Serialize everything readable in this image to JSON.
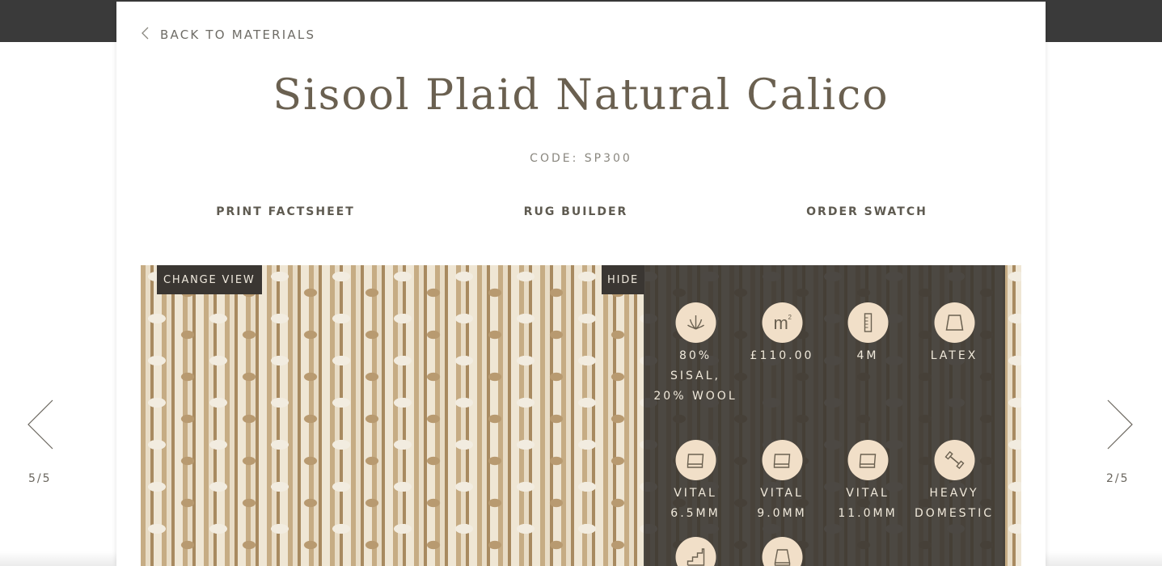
{
  "header": {
    "back_label": "BACK TO MATERIALS"
  },
  "product": {
    "title": "Sisool Plaid Natural Calico",
    "code": "CODE: SP300"
  },
  "actions": {
    "print": "PRINT FACTSHEET",
    "rug_builder": "RUG BUILDER",
    "order_swatch": "ORDER SWATCH"
  },
  "viewer": {
    "change_view": "CHANGE VIEW",
    "hide": "HIDE"
  },
  "specs": [
    {
      "icon": "plant-icon",
      "label": "80% SISAL, 20% WOOL"
    },
    {
      "icon": "square-metre-icon",
      "label": "£110.00"
    },
    {
      "icon": "width-ruler-icon",
      "label": "4M"
    },
    {
      "icon": "latex-backing-icon",
      "label": "LATEX"
    },
    {
      "icon": "underlay-icon",
      "label": "VITAL 6.5MM"
    },
    {
      "icon": "underlay-icon",
      "label": "VITAL 9.0MM"
    },
    {
      "icon": "underlay-icon",
      "label": "VITAL 11.0MM"
    },
    {
      "icon": "dumbbell-icon",
      "label": "HEAVY DOMESTIC"
    },
    {
      "icon": "stairs-icon",
      "label": ""
    },
    {
      "icon": "backing-icon",
      "label": ""
    }
  ],
  "pager": {
    "left": "5/5",
    "right": "2/5"
  },
  "colors": {
    "accent": "#6a6050",
    "icon_bg": "#f1dfc8",
    "panel": "#3a3632"
  }
}
